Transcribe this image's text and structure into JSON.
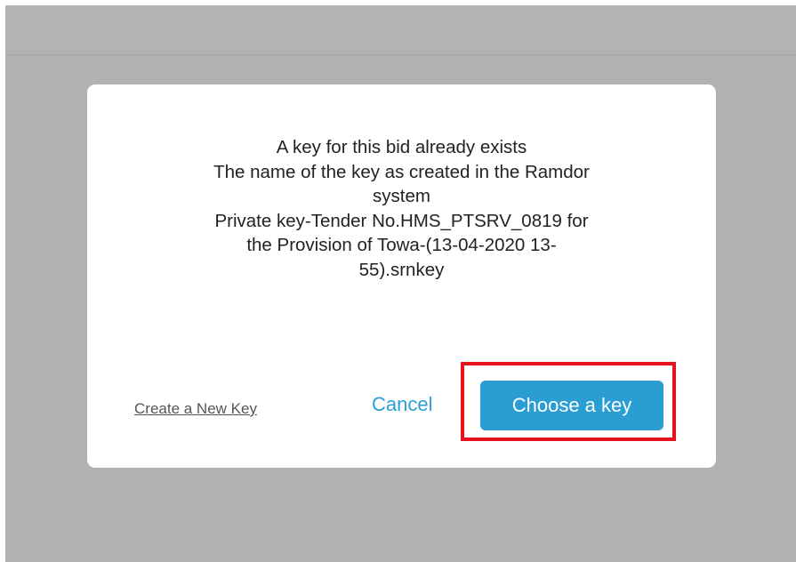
{
  "dialog": {
    "message_lines": [
      "A key for this bid already exists",
      "The name of the key as created in the Ramdor",
      "system",
      "Private key-Tender No.HMS_PTSRV_0819 for",
      "the Provision of Towa-(13-04-2020 13-",
      "55).srnkey"
    ],
    "create_link": "Create a New Key",
    "cancel_label": "Cancel",
    "choose_label": "Choose a key"
  },
  "colors": {
    "overlay": "#b1b1b1",
    "accent": "#2a9ed3",
    "link": "#2b9fd6",
    "highlight": "#e8111d"
  }
}
